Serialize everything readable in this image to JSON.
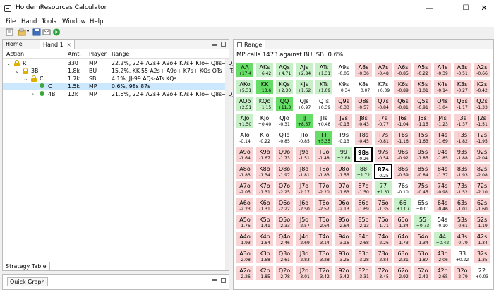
{
  "window": {
    "title": "HoldemResources Calculator",
    "minimize": "—",
    "maximize": "☐",
    "close": "✕"
  },
  "menu": [
    "File",
    "Hand",
    "Tools",
    "Window",
    "Help"
  ],
  "left_tabs": {
    "home": "Home",
    "hand": "Hand 1"
  },
  "columns": {
    "action": "Action",
    "amt": "Amt.",
    "player": "Player",
    "range": "Range"
  },
  "tree": [
    {
      "expander": "⌄",
      "icon": "lock",
      "action": "R",
      "amt": "330",
      "player": "MP",
      "range": "22.2%, 22+ A2s+ A9o+ K7s+ KTo+ Q8s+ QJo J9",
      "indent": 0,
      "selected": false
    },
    {
      "expander": "⌄",
      "icon": "lock",
      "action": "3B",
      "amt": "1.8k",
      "player": "BU",
      "range": "15.2%, KK-55 A2s+ A9o+ K7s+ KQs QTs+ JTs",
      "indent": 1,
      "selected": false
    },
    {
      "expander": "⌄",
      "icon": "lock",
      "action": "C",
      "amt": "1.7k",
      "player": "SB",
      "range": "4.1%, JJ-99 AQs-ATs KQs",
      "indent": 2,
      "selected": false
    },
    {
      "expander": "",
      "icon": "dot",
      "action": "C",
      "amt": "1.5k",
      "player": "MP",
      "range": "0.6%, 98s 87s",
      "indent": 3,
      "selected": true
    },
    {
      "expander": "›",
      "icon": "dot",
      "action": "4B",
      "amt": "12k",
      "player": "MP",
      "range": "21.6%, 22+ A2s+ A9o+ K7s+ KTo+ Q8s+ QJo J9",
      "indent": 3,
      "selected": false
    }
  ],
  "strategy_tab": "Strategy Table",
  "quick_graph": "Quick Graph",
  "range_panel": {
    "tab": "Range",
    "title": "MP calls 1473 against BU, SB: 0.6%"
  },
  "colors": {
    "green_strong": "#66dd66",
    "green_light": "#c8f0c8",
    "red_light": "#f9d3d3",
    "red_mid": "#f4b5b5",
    "white": "#ffffff",
    "selection": "#cce8ff"
  },
  "range_grid": [
    [
      [
        "AA",
        "+17.4",
        "g2"
      ],
      [
        "AKs",
        "+6.42",
        "g1"
      ],
      [
        "AQs",
        "+4.71",
        "g1"
      ],
      [
        "AJs",
        "+2.84",
        "g1"
      ],
      [
        "ATs",
        "+1.31",
        "g1"
      ],
      [
        "A9s",
        "-0.05",
        "w"
      ],
      [
        "A8s",
        "-0.36",
        "r1"
      ],
      [
        "A7s",
        "-0.48",
        "r1"
      ],
      [
        "A6s",
        "-0.85",
        "r1"
      ],
      [
        "A5s",
        "-0.22",
        "r1"
      ],
      [
        "A4s",
        "-0.39",
        "r1"
      ],
      [
        "A3s",
        "-0.51",
        "r1"
      ],
      [
        "A2s",
        "-0.66",
        "r1"
      ]
    ],
    [
      [
        "AKo",
        "+5.31",
        "g1"
      ],
      [
        "KK",
        "+13.6",
        "g2"
      ],
      [
        "KQs",
        "+2.30",
        "g1"
      ],
      [
        "KJs",
        "+1.62",
        "g1"
      ],
      [
        "KTs",
        "+1.09",
        "g1"
      ],
      [
        "K9s",
        "+0.34",
        "w"
      ],
      [
        "K8s",
        "+0.07",
        "w"
      ],
      [
        "K7s",
        "+0.09",
        "w"
      ],
      [
        "K6s",
        "-0.89",
        "r1"
      ],
      [
        "K5s",
        "-1.01",
        "r1"
      ],
      [
        "K4s",
        "-0.14",
        "r1"
      ],
      [
        "K3s",
        "-0.27",
        "r1"
      ],
      [
        "K2s",
        "-0.42",
        "r1"
      ]
    ],
    [
      [
        "AQo",
        "+2.51",
        "g1"
      ],
      [
        "KQo",
        "+1.15",
        "g1"
      ],
      [
        "QQ",
        "+11.3",
        "g2"
      ],
      [
        "QJs",
        "+0.97",
        "w"
      ],
      [
        "QTs",
        "+0.39",
        "w"
      ],
      [
        "Q9s",
        "-0.33",
        "r1"
      ],
      [
        "Q8s",
        "-0.57",
        "r1"
      ],
      [
        "Q7s",
        "-0.84",
        "r1"
      ],
      [
        "Q6s",
        "-0.81",
        "r1"
      ],
      [
        "Q5s",
        "-0.91",
        "r1"
      ],
      [
        "Q4s",
        "-1.04",
        "r1"
      ],
      [
        "Q3s",
        "-1.17",
        "r1"
      ],
      [
        "Q2s",
        "-1.33",
        "r1"
      ]
    ],
    [
      [
        "AJo",
        "+1.50",
        "g1"
      ],
      [
        "KJo",
        "+0.40",
        "w"
      ],
      [
        "QJo",
        "-0.31",
        "w"
      ],
      [
        "JJ",
        "+8.57",
        "g2"
      ],
      [
        "JTs",
        "+0.48",
        "w"
      ],
      [
        "J9s",
        "-0.15",
        "r1"
      ],
      [
        "J8s",
        "-0.43",
        "r1"
      ],
      [
        "J7s",
        "-0.77",
        "r1"
      ],
      [
        "J6s",
        "-1.04",
        "r1"
      ],
      [
        "J5s",
        "-1.15",
        "r1"
      ],
      [
        "J4s",
        "-1.23",
        "r1"
      ],
      [
        "J3s",
        "-1.37",
        "r1"
      ],
      [
        "J2s",
        "-1.51",
        "r1"
      ]
    ],
    [
      [
        "ATo",
        "-0.14",
        "w"
      ],
      [
        "KTo",
        "-0.22",
        "w"
      ],
      [
        "QTo",
        "-0.85",
        "w"
      ],
      [
        "JTo",
        "-0.85",
        "w"
      ],
      [
        "TT",
        "+5.35",
        "g2"
      ],
      [
        "T9s",
        "-0.13",
        "w"
      ],
      [
        "T8s",
        "-0.45",
        "r1"
      ],
      [
        "T7s",
        "-0.81",
        "r1"
      ],
      [
        "T6s",
        "-1.16",
        "r1"
      ],
      [
        "T5s",
        "-1.63",
        "r1"
      ],
      [
        "T4s",
        "-1.69",
        "r1"
      ],
      [
        "T3s",
        "-1.82",
        "r1"
      ],
      [
        "T2s",
        "-1.95",
        "r1"
      ]
    ],
    [
      [
        "A9o",
        "-1.64",
        "r1"
      ],
      [
        "K9o",
        "-1.67",
        "r1"
      ],
      [
        "Q9o",
        "-1.73",
        "r1"
      ],
      [
        "J9o",
        "-1.51",
        "r1"
      ],
      [
        "T9o",
        "-1.48",
        "r1"
      ],
      [
        "99",
        "+2.88",
        "g1"
      ],
      [
        "98s",
        "-0.26",
        "hl"
      ],
      [
        "97s",
        "-0.54",
        "r1"
      ],
      [
        "96s",
        "-0.92",
        "r1"
      ],
      [
        "95s",
        "-1.85",
        "r1"
      ],
      [
        "94s",
        "-1.85",
        "r1"
      ],
      [
        "93s",
        "-1.88",
        "r1"
      ],
      [
        "92s",
        "-2.04",
        "r1"
      ]
    ],
    [
      [
        "A8o",
        "-1.83",
        "r1"
      ],
      [
        "K8o",
        "-1.34",
        "r1"
      ],
      [
        "Q8o",
        "-1.97",
        "r1"
      ],
      [
        "J8o",
        "-1.81",
        "r1"
      ],
      [
        "T8o",
        "-1.83",
        "r1"
      ],
      [
        "98o",
        "-1.55",
        "r1"
      ],
      [
        "88",
        "+1.72",
        "g1"
      ],
      [
        "87s",
        "-0.25",
        "hl"
      ],
      [
        "86s",
        "-0.59",
        "r1"
      ],
      [
        "85s",
        "-0.84",
        "r1"
      ],
      [
        "84s",
        "-1.37",
        "r1"
      ],
      [
        "83s",
        "-1.93",
        "r1"
      ],
      [
        "82s",
        "-2.08",
        "r1"
      ]
    ],
    [
      [
        "A7o",
        "-2.05",
        "r1"
      ],
      [
        "K7o",
        "-1.31",
        "r1"
      ],
      [
        "Q7o",
        "-2.25",
        "r1"
      ],
      [
        "J7o",
        "-2.17",
        "r1"
      ],
      [
        "T7o",
        "-2.20",
        "r1"
      ],
      [
        "97o",
        "-1.63",
        "r1"
      ],
      [
        "87o",
        "-1.50",
        "r1"
      ],
      [
        "77",
        "+1.31",
        "g1"
      ],
      [
        "76s",
        "-0.10",
        "w"
      ],
      [
        "75s",
        "-0.45",
        "r1"
      ],
      [
        "74s",
        "-0.98",
        "r1"
      ],
      [
        "73s",
        "-1.52",
        "r1"
      ],
      [
        "72s",
        "-2.10",
        "r1"
      ]
    ],
    [
      [
        "A6o",
        "-2.23",
        "r1"
      ],
      [
        "K6o",
        "-1.31",
        "r1"
      ],
      [
        "Q6o",
        "-2.22",
        "r1"
      ],
      [
        "J6o",
        "-2.50",
        "r1"
      ],
      [
        "T6o",
        "-2.57",
        "r1"
      ],
      [
        "96o",
        "-2.13",
        "r1"
      ],
      [
        "86o",
        "-1.69",
        "r1"
      ],
      [
        "76o",
        "-1.35",
        "r1"
      ],
      [
        "66",
        "+1.07",
        "g1"
      ],
      [
        "65s",
        "+0.01",
        "w"
      ],
      [
        "64s",
        "-0.46",
        "r1"
      ],
      [
        "63s",
        "-1.01",
        "r1"
      ],
      [
        "62s",
        "-1.60",
        "r1"
      ]
    ],
    [
      [
        "A5o",
        "-1.76",
        "r1"
      ],
      [
        "K5o",
        "-1.41",
        "r1"
      ],
      [
        "Q5o",
        "-2.33",
        "r1"
      ],
      [
        "J5o",
        "-2.57",
        "r1"
      ],
      [
        "T5o",
        "-2.64",
        "r1"
      ],
      [
        "95o",
        "-2.64",
        "r1"
      ],
      [
        "85o",
        "-2.13",
        "r1"
      ],
      [
        "75o",
        "-1.71",
        "r1"
      ],
      [
        "65o",
        "-1.34",
        "r1"
      ],
      [
        "55",
        "+0.73",
        "g1"
      ],
      [
        "54s",
        "-0.10",
        "w"
      ],
      [
        "53s",
        "-0.61",
        "r1"
      ],
      [
        "52s",
        "-1.19",
        "r1"
      ]
    ],
    [
      [
        "A4o",
        "-1.93",
        "r1"
      ],
      [
        "K4o",
        "-1.64",
        "r1"
      ],
      [
        "Q4o",
        "-2.46",
        "r1"
      ],
      [
        "J4o",
        "-2.69",
        "r1"
      ],
      [
        "T4o",
        "-3.14",
        "r1"
      ],
      [
        "94o",
        "-3.16",
        "r1"
      ],
      [
        "84o",
        "-2.68",
        "r1"
      ],
      [
        "74o",
        "-2.26",
        "r1"
      ],
      [
        "64o",
        "-1.73",
        "r1"
      ],
      [
        "54o",
        "-1.34",
        "r1"
      ],
      [
        "44",
        "+0.42",
        "g1"
      ],
      [
        "43s",
        "-0.79",
        "r1"
      ],
      [
        "42s",
        "-1.34",
        "r1"
      ]
    ],
    [
      [
        "A3o",
        "-2.08",
        "r1"
      ],
      [
        "K3o",
        "-1.68",
        "r1"
      ],
      [
        "Q3o",
        "-2.61",
        "r1"
      ],
      [
        "J3o",
        "-2.83",
        "r1"
      ],
      [
        "T3o",
        "-3.28",
        "r1"
      ],
      [
        "93o",
        "-3.25",
        "r1"
      ],
      [
        "83o",
        "-3.28",
        "r1"
      ],
      [
        "73o",
        "-2.84",
        "r1"
      ],
      [
        "63o",
        "-2.31",
        "r1"
      ],
      [
        "53o",
        "-1.87",
        "r1"
      ],
      [
        "43o",
        "-2.06",
        "r1"
      ],
      [
        "33",
        "+0.22",
        "w"
      ],
      [
        "32s",
        "-1.35",
        "r1"
      ]
    ],
    [
      [
        "A2o",
        "-2.26",
        "r1"
      ],
      [
        "K2o",
        "-1.85",
        "r1"
      ],
      [
        "Q2o",
        "-2.78",
        "r1"
      ],
      [
        "J2o",
        "-3.01",
        "r1"
      ],
      [
        "T2o",
        "-3.42",
        "r1"
      ],
      [
        "92o",
        "-3.42",
        "r1"
      ],
      [
        "82o",
        "-3.31",
        "r1"
      ],
      [
        "72o",
        "-3.45",
        "r1"
      ],
      [
        "62o",
        "-2.92",
        "r1"
      ],
      [
        "52o",
        "-2.49",
        "r1"
      ],
      [
        "42o",
        "-2.65",
        "r1"
      ],
      [
        "32o",
        "-2.79",
        "r1"
      ],
      [
        "22",
        "+0.03",
        "w"
      ]
    ]
  ]
}
